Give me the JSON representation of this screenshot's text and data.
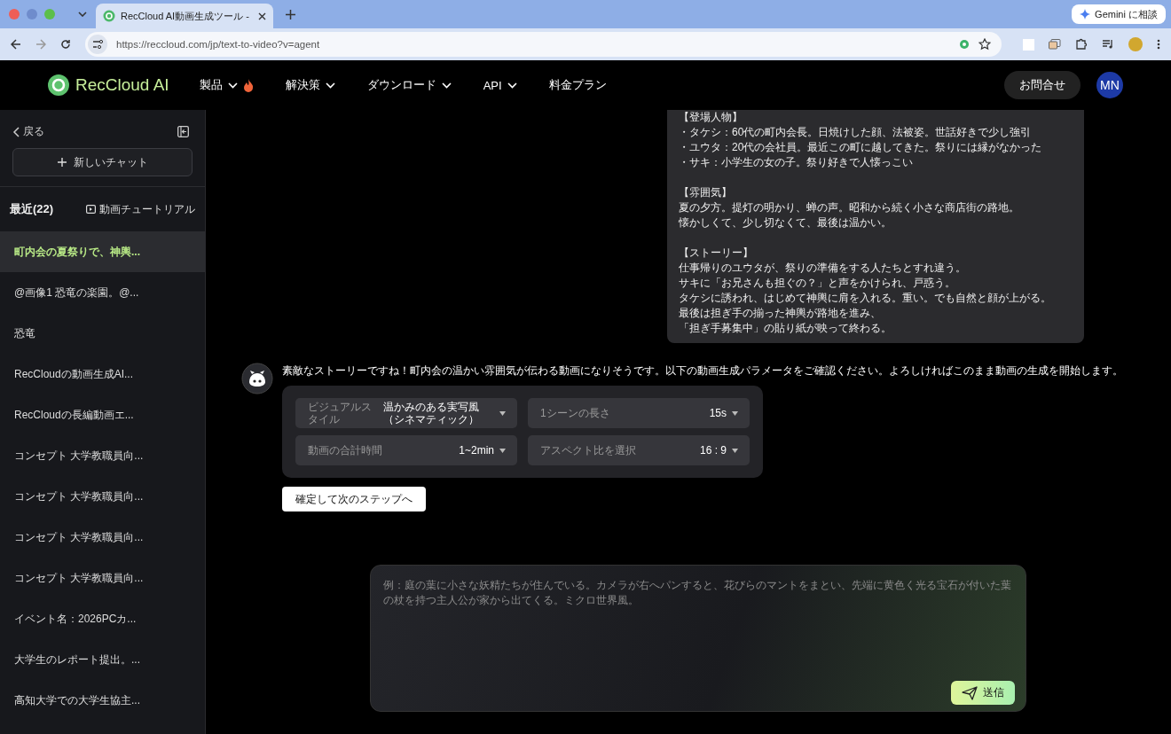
{
  "browser": {
    "tab_title": "RecCloud AI動画生成ツール -",
    "url": "https://reccloud.com/jp/text-to-video?v=agent",
    "gemini_button": "Gemini に相談"
  },
  "header": {
    "logo": "RecCloud AI",
    "nav": [
      {
        "label": "製品",
        "caret": true,
        "hot": true
      },
      {
        "label": "解決策",
        "caret": true,
        "hot": false
      },
      {
        "label": "ダウンロード",
        "caret": true,
        "hot": false
      },
      {
        "label": "API",
        "caret": true,
        "hot": false
      },
      {
        "label": "料金プラン",
        "caret": false,
        "hot": false
      }
    ],
    "contact_button": "お問合せ",
    "avatar": "MN"
  },
  "sidebar": {
    "back": "戻る",
    "new_chat": "新しいチャット",
    "recent_label": "最近(22)",
    "tutorial_link": "動画チュートリアル",
    "items": [
      {
        "label": "町内会の夏祭りで、神輿...",
        "selected": true
      },
      {
        "label": "@画像1 恐竜の楽園。@...",
        "selected": false
      },
      {
        "label": "恐竜",
        "selected": false
      },
      {
        "label": "RecCloudの動画生成AI...",
        "selected": false
      },
      {
        "label": "RecCloudの長編動画エ...",
        "selected": false
      },
      {
        "label": "コンセプト 大学教職員向...",
        "selected": false
      },
      {
        "label": "コンセプト 大学教職員向...",
        "selected": false
      },
      {
        "label": "コンセプト 大学教職員向...",
        "selected": false
      },
      {
        "label": "コンセプト 大学教職員向...",
        "selected": false
      },
      {
        "label": "イベント名：2026PCカ...",
        "selected": false
      },
      {
        "label": "大学生のレポート提出。...",
        "selected": false
      },
      {
        "label": "高知大学での大学生協主...",
        "selected": false
      }
    ]
  },
  "user_message": {
    "sections": [
      {
        "heading": "【登場人物】",
        "lines": [
          "・タケシ：60代の町内会長。日焼けした顔、法被姿。世話好きで少し強引",
          "・ユウタ：20代の会社員。最近この町に越してきた。祭りには縁がなかった",
          "・サキ：小学生の女の子。祭り好きで人懐っこい"
        ]
      },
      {
        "heading": "【雰囲気】",
        "lines": [
          "夏の夕方。提灯の明かり、蝉の声。昭和から続く小さな商店街の路地。",
          "懐かしくて、少し切なくて、最後は温かい。"
        ]
      },
      {
        "heading": "【ストーリー】",
        "lines": [
          "仕事帰りのユウタが、祭りの準備をする人たちとすれ違う。",
          "サキに「お兄さんも担ぐの？」と声をかけられ、戸惑う。",
          "タケシに誘われ、はじめて神輿に肩を入れる。重い。でも自然と顔が上がる。",
          "最後は担ぎ手の揃った神輿が路地を進み、",
          "「担ぎ手募集中」の貼り紙が映って終わる。"
        ]
      }
    ]
  },
  "bot_message": {
    "text": "素敵なストーリーですね！町内会の温かい雰囲気が伝わる動画になりそうです。以下の動画生成パラメータをご確認ください。よろしければこのまま動画の生成を開始します。",
    "params": [
      {
        "kind": "dropdown",
        "label": "ビジュアルスタイル",
        "value": "温かみのある実写風（シネマティック）"
      },
      {
        "kind": "dropdown",
        "label": "1シーンの長さ",
        "value": "15s"
      },
      {
        "kind": "dropdown",
        "label": "動画の合計時間",
        "value": "1~2min"
      },
      {
        "kind": "dropdown",
        "label": "アスペクト比を選択",
        "value": "16 : 9"
      }
    ],
    "confirm_button": "確定して次のステップへ"
  },
  "composer": {
    "placeholder": "例：庭の葉に小さな妖精たちが住んでいる。カメラが右へパンすると、花びらのマントをまとい、先端に黄色く光る宝石が付いた葉の杖を持つ主人公が家から出てくる。ミクロ世界風。",
    "send_button": "送信"
  }
}
